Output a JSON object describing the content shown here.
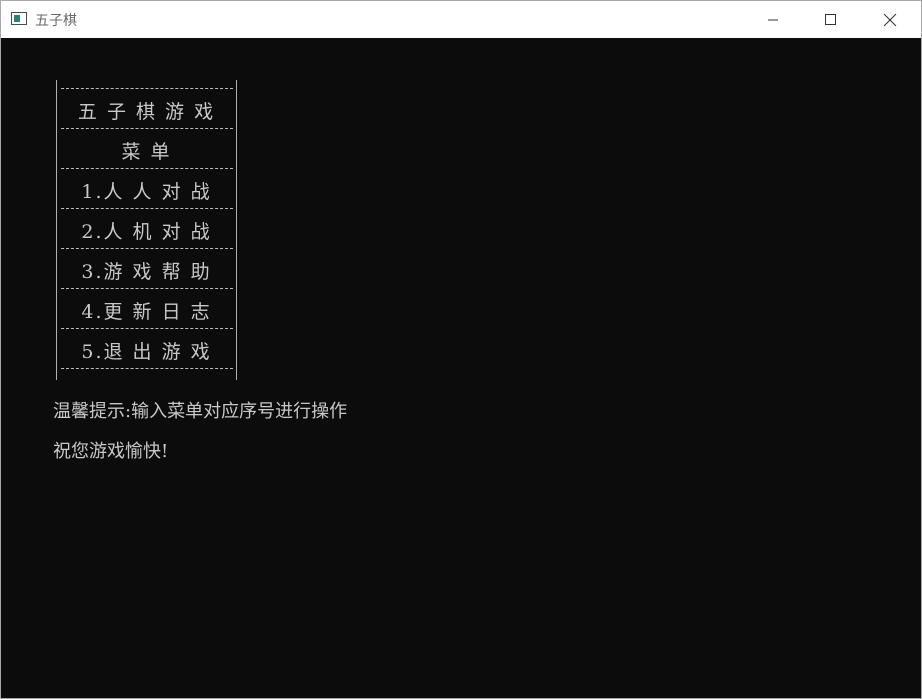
{
  "window": {
    "title": "五子棋"
  },
  "menu": {
    "title": "五 子 棋 游 戏",
    "subtitle": "菜   单",
    "items": [
      {
        "label": "1.人 人 对 战"
      },
      {
        "label": "2.人 机 对 战"
      },
      {
        "label": "3.游 戏 帮 助"
      },
      {
        "label": "4.更 新 日 志"
      },
      {
        "label": "5.退 出 游 戏"
      }
    ]
  },
  "tips": {
    "hint": "温馨提示:输入菜单对应序号进行操作",
    "wish": "祝您游戏愉快!"
  },
  "colors": {
    "console_bg": "#0c0c0c",
    "console_text": "#cccccc",
    "titlebar_bg": "#ffffff"
  },
  "icons": {
    "app": "console-app-icon",
    "minimize": "minimize-icon",
    "maximize": "maximize-icon",
    "close": "close-icon"
  }
}
